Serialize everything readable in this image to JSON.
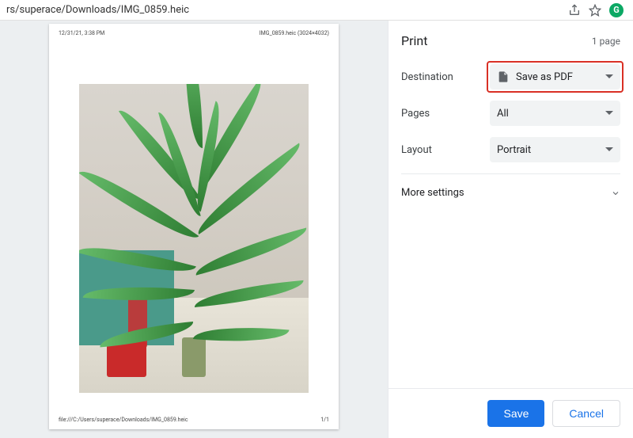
{
  "address_bar": {
    "path": "rs/superace/Downloads/IMG_0859.heic"
  },
  "extension_badge": "G",
  "preview": {
    "timestamp": "12/31/21, 3:38 PM",
    "title": "IMG_0859.heic (3024×4032)",
    "footer_path": "file:///C:/Users/superace/Downloads/IMG_0859.heic",
    "page_indicator": "1/1"
  },
  "print_panel": {
    "title": "Print",
    "page_count": "1 page",
    "rows": {
      "destination": {
        "label": "Destination",
        "value": "Save as PDF"
      },
      "pages": {
        "label": "Pages",
        "value": "All"
      },
      "layout": {
        "label": "Layout",
        "value": "Portrait"
      }
    },
    "more_settings": "More settings",
    "buttons": {
      "save": "Save",
      "cancel": "Cancel"
    }
  }
}
